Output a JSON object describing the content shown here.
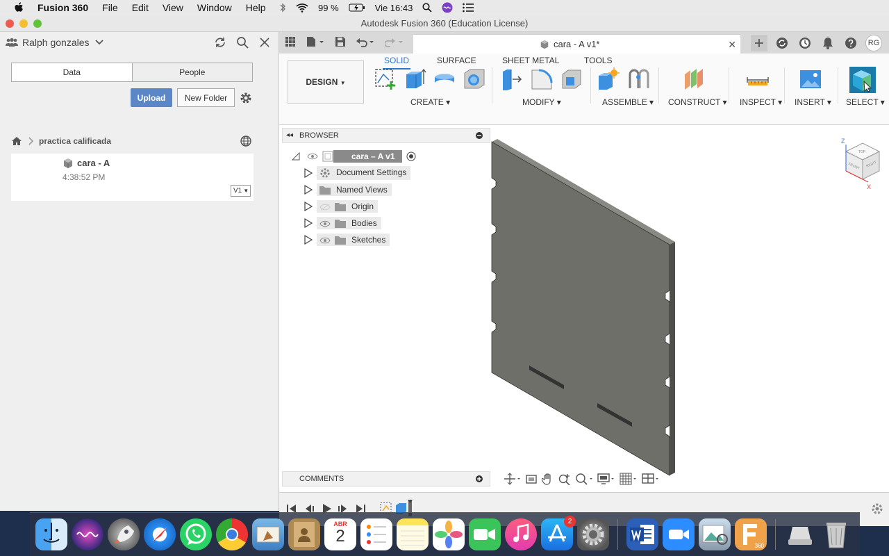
{
  "menubar": {
    "app": "Fusion 360",
    "items": [
      "File",
      "Edit",
      "View",
      "Window",
      "Help"
    ],
    "battery": "99 %",
    "clock": "Vie 16:43"
  },
  "window": {
    "title": "Autodesk Fusion 360 (Education License)"
  },
  "left_panel": {
    "user": "Ralph gonzales",
    "tabs": [
      "Data",
      "People"
    ],
    "upload": "Upload",
    "new_folder": "New Folder",
    "breadcrumb": "practica calificada",
    "file": {
      "name": "cara - A",
      "time": "4:38:52 PM",
      "version": "V1"
    }
  },
  "document": {
    "tab_title": "cara - A v1*",
    "avatar": "RG"
  },
  "ribbon": {
    "workspace": "DESIGN",
    "tabs": [
      "SOLID",
      "SURFACE",
      "SHEET METAL",
      "TOOLS"
    ],
    "groups": [
      "CREATE",
      "MODIFY",
      "ASSEMBLE",
      "CONSTRUCT",
      "INSPECT",
      "INSERT",
      "SELECT"
    ]
  },
  "browser": {
    "title": "BROWSER",
    "root": "cara – A v1",
    "items": [
      "Document Settings",
      "Named Views",
      "Origin",
      "Bodies",
      "Sketches"
    ]
  },
  "comments": "COMMENTS",
  "viewcube": {
    "z": "Z",
    "x": "X",
    "top": "TOP",
    "front": "FRONT",
    "right": "RIGHT"
  },
  "dock": {
    "calendar_month": "ABR",
    "calendar_day": "2",
    "appstore_badge": "2",
    "fusion_label": "360"
  },
  "colors": {
    "accent": "#2e75c5",
    "upload": "#5b87c6",
    "model": "#6f6f6a"
  }
}
